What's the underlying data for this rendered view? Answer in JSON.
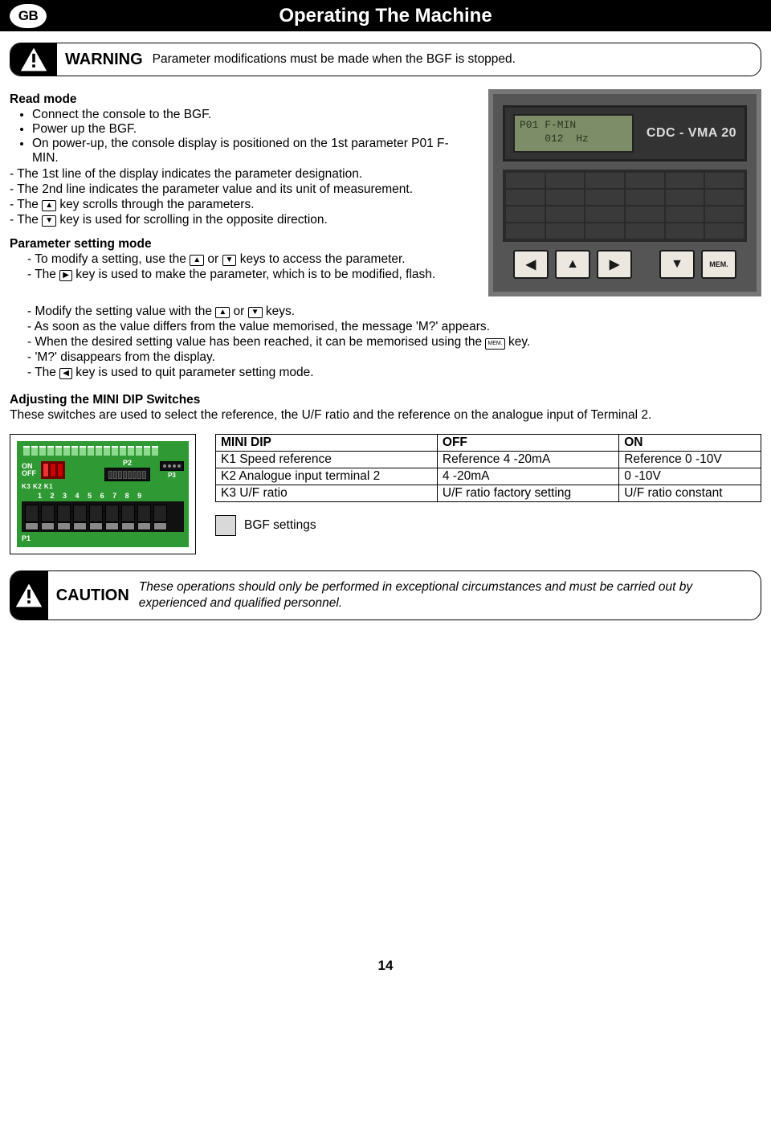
{
  "locale_badge": "GB",
  "title": "Operating The Machine",
  "warning": {
    "label": "WARNING",
    "text": "Parameter modifications must be made when the BGF is stopped."
  },
  "read_mode": {
    "heading": "Read mode",
    "b1": "Connect the console to the BGF.",
    "b2": "Power up the BGF.",
    "b3": "On power-up, the console display is positioned on the 1st parameter P01 F-MIN.",
    "l1": "- The 1st line of the display indicates the parameter designation.",
    "l2": "- The 2nd line indicates the parameter value and its unit of measurement.",
    "l3a": "- The ",
    "l3b": " key scrolls through the parameters.",
    "l4a": "- The ",
    "l4b": " key is used for scrolling in the opposite direction."
  },
  "param_mode": {
    "heading": "Parameter setting mode",
    "l1a": "- To modify a setting, use the ",
    "l1b": " or ",
    "l1c": " keys to access the parameter.",
    "l2a": "- The ",
    "l2b": " key is used to make the parameter, which is to be modified, flash.",
    "l3a": "- Modify the setting value with the ",
    "l3b": " or ",
    "l3c": " keys.",
    "l4": "- As soon as the value differs from the value memorised, the message 'M?' appears.",
    "l5a": "- When the desired setting value has been reached, it can be memorised using the ",
    "l5b": " key.",
    "l6": "- 'M?' disappears from the display.",
    "l7a": "- The ",
    "l7b": " key is used to quit parameter setting mode."
  },
  "keys": {
    "up": "▲",
    "down": "▼",
    "right": "▶",
    "left": "◀",
    "mem": "MEM."
  },
  "console": {
    "brand": "CDC - VMA 20",
    "lcd_line1": "P01 F-MIN",
    "lcd_line2": "    012  Hz"
  },
  "dip": {
    "heading": "Adjusting the MINI DIP Switches",
    "intro": "These switches are used to select the reference, the U/F ratio and the reference on the analogue input of Terminal 2.",
    "diagram": {
      "on": "ON",
      "off": "OFF",
      "p1": "P1",
      "p2": "P2",
      "p3": "P3",
      "k": "K3 K2 K1",
      "nums": [
        "1",
        "2",
        "3",
        "4",
        "5",
        "6",
        "7",
        "8",
        "9"
      ]
    },
    "table": {
      "h1": "MINI DIP",
      "h2": "OFF",
      "h3": "ON",
      "r1c1": "K1 Speed reference",
      "r1c2": "Reference 4 -20mA",
      "r1c3": "Reference 0 -10V",
      "r2c1": "K2 Analogue input terminal 2",
      "r2c2": "4 -20mA",
      "r2c3": "0 -10V",
      "r3c1": "K3 U/F ratio",
      "r3c2": "U/F ratio factory setting",
      "r3c3": "U/F ratio constant"
    },
    "bgf_settings": "BGF settings"
  },
  "caution": {
    "label": "CAUTION",
    "text": "These operations should only be performed in exceptional circumstances and must be carried out by experienced and qualified personnel."
  },
  "page_number": "14"
}
